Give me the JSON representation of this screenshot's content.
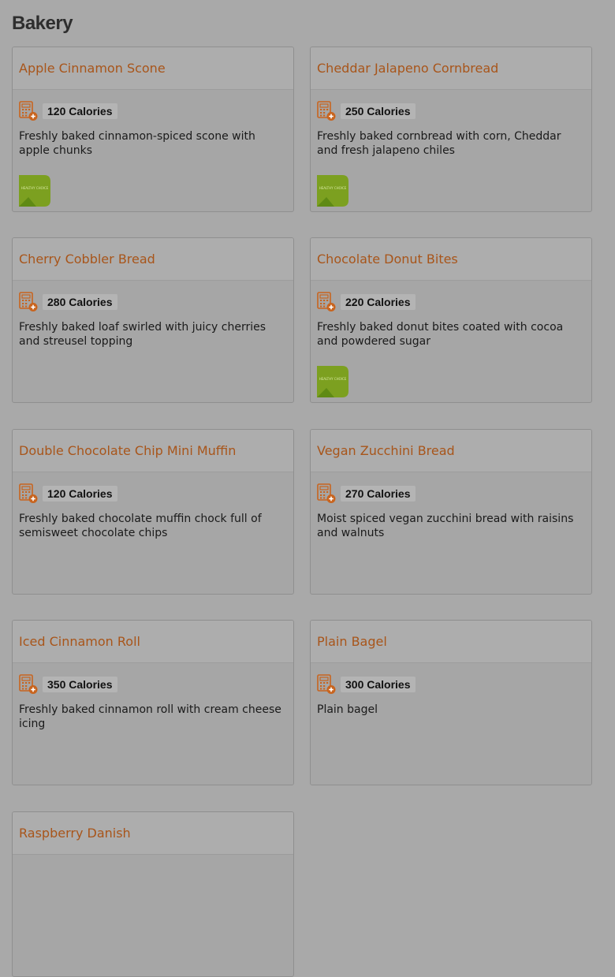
{
  "section": {
    "title": "Bakery"
  },
  "items": [
    {
      "name": "Apple Cinnamon Scone",
      "calories": "120 Calories",
      "description": "Freshly baked cinnamon-spiced scone with apple chunks",
      "badge": true,
      "badge_text": "HEALTHY CHOICE"
    },
    {
      "name": "Cheddar Jalapeno Cornbread",
      "calories": "250 Calories",
      "description": "Freshly baked cornbread with corn, Cheddar and fresh jalapeno chiles",
      "badge": true,
      "badge_text": "HEALTHY CHOICE"
    },
    {
      "name": "Cherry Cobbler Bread",
      "calories": "280 Calories",
      "description": "Freshly baked loaf swirled with juicy cherries and streusel topping",
      "badge": false
    },
    {
      "name": "Chocolate Donut Bites",
      "calories": "220 Calories",
      "description": "Freshly baked donut bites coated with cocoa and powdered sugar",
      "badge": true,
      "badge_text": "HEALTHY CHOICE"
    },
    {
      "name": "Double Chocolate Chip Mini Muffin",
      "calories": "120 Calories",
      "description": "Freshly baked chocolate muffin chock full of semisweet chocolate chips",
      "badge": false
    },
    {
      "name": "Vegan Zucchini Bread",
      "calories": "270 Calories",
      "description": "Moist spiced vegan zucchini bread with raisins and walnuts",
      "badge": false
    },
    {
      "name": "Iced Cinnamon Roll",
      "calories": "350 Calories",
      "description": "Freshly baked cinnamon roll with cream cheese icing",
      "badge": false
    },
    {
      "name": "Plain Bagel",
      "calories": "300 Calories",
      "description": "Plain bagel",
      "badge": false
    },
    {
      "name": "Raspberry Danish",
      "calories": "",
      "description": "",
      "badge": false
    }
  ],
  "colors": {
    "title": "#a8551a",
    "badge_green": "#7ca020",
    "calc_orange": "#c8641e"
  }
}
